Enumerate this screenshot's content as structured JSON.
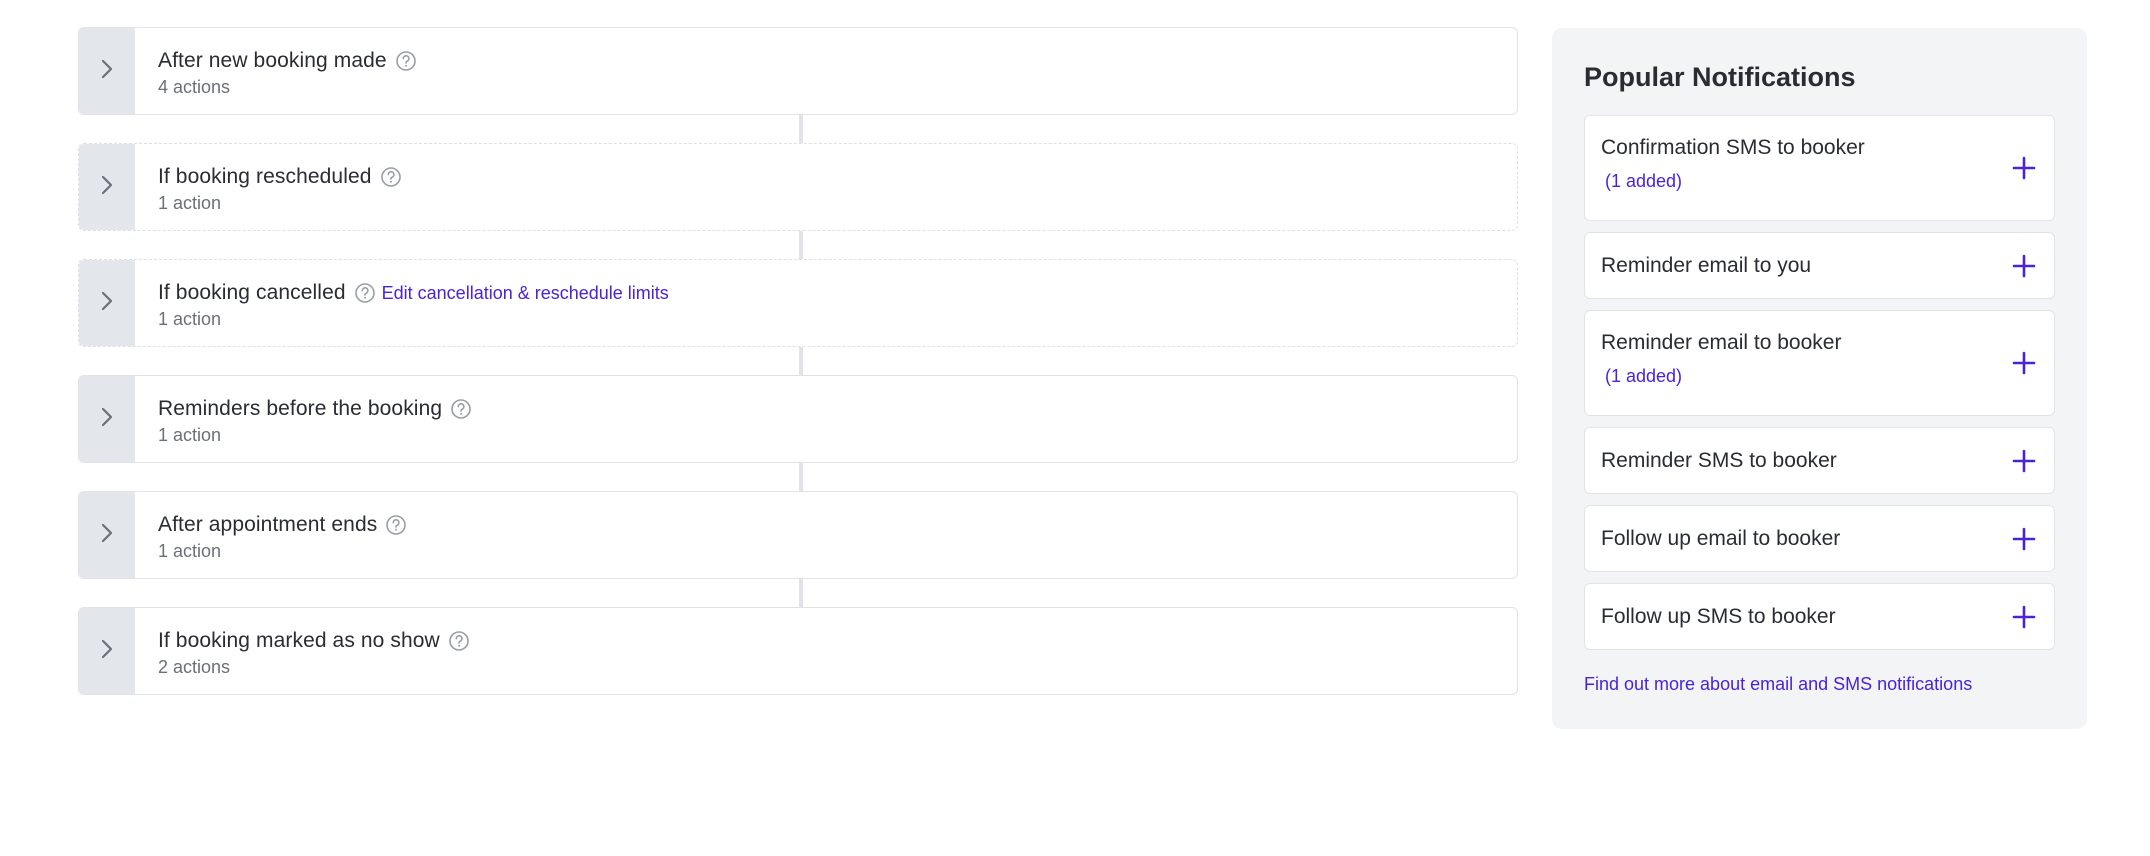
{
  "triggers": [
    {
      "title": "After new booking made",
      "count": "4 actions",
      "link": null,
      "border": "solid"
    },
    {
      "title": "If booking rescheduled",
      "count": "1 action",
      "link": null,
      "border": "dashed"
    },
    {
      "title": "If booking cancelled",
      "count": "1 action",
      "link": "Edit cancellation & reschedule limits",
      "border": "dashed"
    },
    {
      "title": "Reminders before the booking",
      "count": "1 action",
      "link": null,
      "border": "solid"
    },
    {
      "title": "After appointment ends",
      "count": "1 action",
      "link": null,
      "border": "solid"
    },
    {
      "title": "If booking marked as no show",
      "count": "2 actions",
      "link": null,
      "border": "solid"
    }
  ],
  "icons": {
    "expand": "chevron-right-icon",
    "help": "question-circle-icon",
    "add": "plus-icon"
  },
  "popular": {
    "title": "Popular Notifications",
    "items": [
      {
        "label": "Confirmation SMS to booker",
        "added": "(1 added)"
      },
      {
        "label": "Reminder email to you",
        "added": null
      },
      {
        "label": "Reminder email to booker",
        "added": "(1 added)"
      },
      {
        "label": "Reminder SMS to booker",
        "added": null
      },
      {
        "label": "Follow up email to booker",
        "added": null
      },
      {
        "label": "Follow up SMS to booker",
        "added": null
      }
    ],
    "footer_link": "Find out more about email and SMS notifications"
  },
  "colors": {
    "accent": "#4b22d6",
    "toggle_bg": "#e3e6ea",
    "panel_bg": "#f3f4f6",
    "border": "#e1e3e8"
  }
}
